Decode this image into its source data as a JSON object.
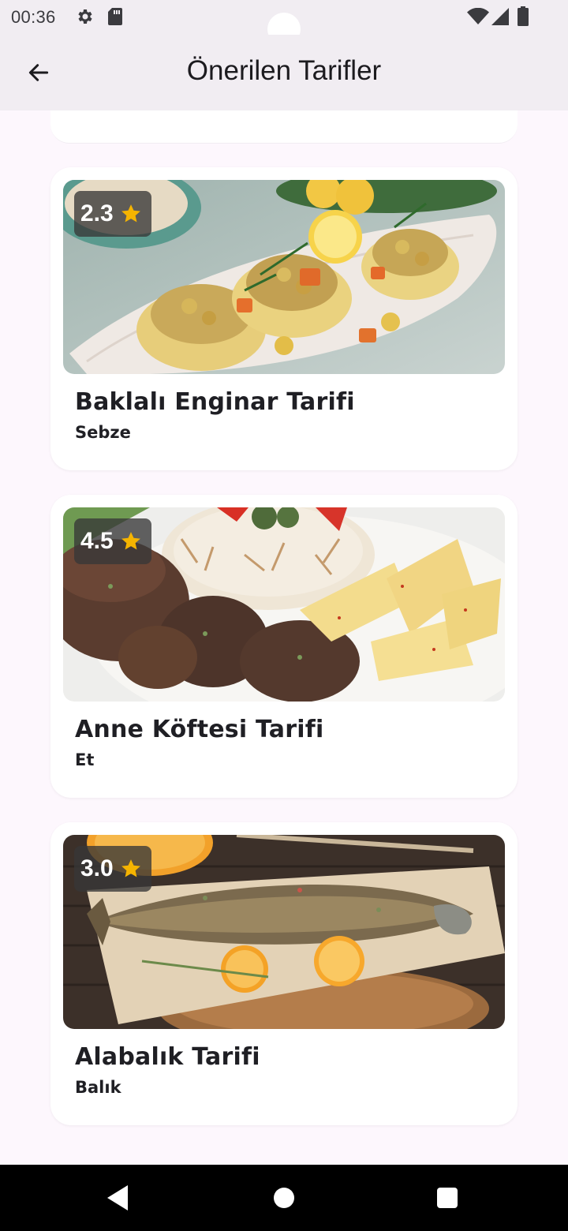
{
  "status_bar": {
    "time": "00:36",
    "icons": [
      "gear-icon",
      "sd-card-icon",
      "wifi-icon",
      "signal-icon",
      "battery-icon"
    ]
  },
  "app_bar": {
    "title": "Önerilen Tarifler",
    "back_icon": "arrow-left-icon"
  },
  "recipes": [
    {
      "rating": "2.3",
      "title": "Baklalı Enginar Tarifi",
      "category": "Sebze",
      "image": "stuffed-artichokes-photo"
    },
    {
      "rating": "4.5",
      "title": "Anne Köftesi Tarifi",
      "category": "Et",
      "image": "meatballs-rice-potatoes-photo"
    },
    {
      "rating": "3.0",
      "title": "Alabalık Tarifi",
      "category": "Balık",
      "image": "grilled-trout-photo"
    }
  ],
  "colors": {
    "background": "#fdf7fd",
    "app_bar": "#f1edf2",
    "card": "#ffffff",
    "star": "#f5b400",
    "rating_badge": "#373737"
  },
  "nav_bar": {
    "icons": [
      "nav-back-icon",
      "nav-home-icon",
      "nav-recents-icon"
    ]
  }
}
